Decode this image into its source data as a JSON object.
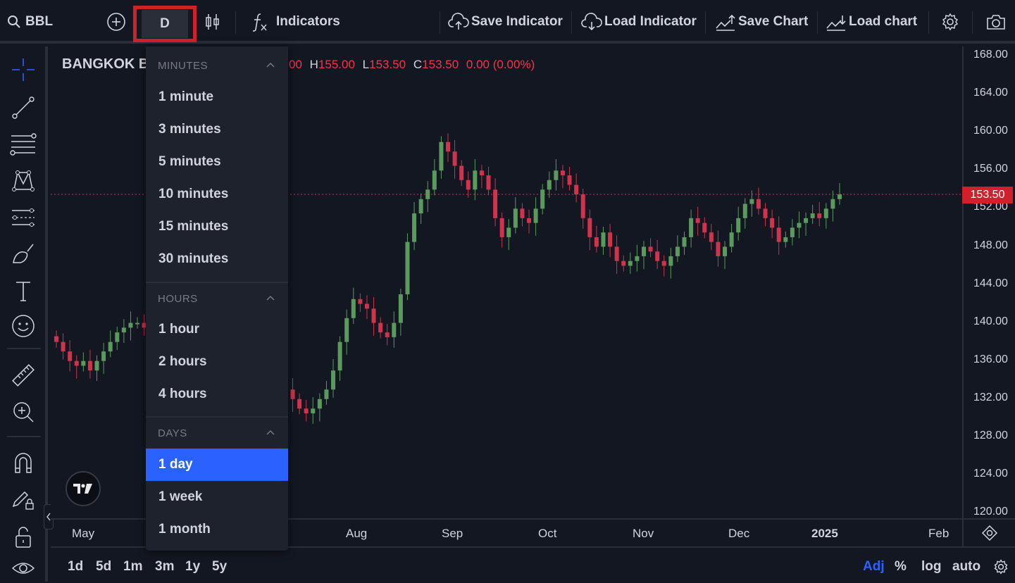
{
  "toolbar": {
    "symbol": "BBL",
    "interval": "D",
    "indicators": "Indicators",
    "save_indicator": "Save Indicator",
    "load_indicator": "Load Indicator",
    "save_chart": "Save Chart",
    "load_chart": "Load chart"
  },
  "legend": {
    "symbol_name": "BANGKOK B",
    "open_value": "00",
    "high_label": "H",
    "high_value": "155.00",
    "low_label": "L",
    "low_value": "153.50",
    "close_label": "C",
    "close_value": "153.50",
    "change": "0.00 (0.00%)"
  },
  "interval_menu": {
    "sections": [
      {
        "title": "MINUTES",
        "items": [
          "1 minute",
          "3 minutes",
          "5 minutes",
          "10 minutes",
          "15 minutes",
          "30 minutes"
        ]
      },
      {
        "title": "HOURS",
        "items": [
          "1 hour",
          "2 hours",
          "4 hours"
        ]
      },
      {
        "title": "DAYS",
        "items": [
          "1 day",
          "1 week",
          "1 month"
        ]
      }
    ],
    "selected": "1 day"
  },
  "y_axis": {
    "ticks": [
      "168.00",
      "164.00",
      "160.00",
      "156.00",
      "152.00",
      "148.00",
      "144.00",
      "140.00",
      "136.00",
      "132.00",
      "128.00",
      "124.00",
      "120.00"
    ],
    "last_price": "153.50"
  },
  "x_axis": {
    "ticks": [
      "May",
      "Aug",
      "Sep",
      "Oct",
      "Nov",
      "Dec",
      "2025",
      "Feb"
    ]
  },
  "bottom": {
    "ranges": [
      "1d",
      "5d",
      "1m",
      "3m",
      "1y",
      "5y"
    ],
    "adj": "Adj",
    "percent": "%",
    "log": "log",
    "auto": "auto"
  },
  "colors": {
    "up": "#5b9a5d",
    "down": "#d0334b",
    "accent": "#2962ff",
    "highlight": "#d0202c"
  },
  "chart_data": {
    "type": "candlestick",
    "closes": [
      138,
      137,
      136,
      135.5,
      136,
      135,
      136,
      137,
      138,
      139,
      139.5,
      140,
      140,
      139.5,
      140,
      140.2,
      140,
      139.5,
      140,
      137,
      136,
      134,
      133,
      135,
      136.5,
      135,
      134,
      133,
      132.5,
      134,
      135.5,
      137,
      136,
      134,
      133,
      132,
      131,
      130.5,
      131,
      132,
      133,
      135,
      138,
      140.5,
      142.5,
      142,
      141.5,
      140,
      139,
      138.5,
      140,
      143,
      148.5,
      151.5,
      153,
      154,
      156,
      159,
      158,
      156.5,
      155,
      154,
      156,
      155.5,
      154,
      151,
      149,
      150,
      152,
      151,
      150.5,
      152,
      154,
      155,
      156,
      155.5,
      154.5,
      153.5,
      151,
      149,
      148,
      149.5,
      148,
      146.5,
      146,
      146.5,
      147,
      148,
      147.5,
      146.5,
      146,
      147,
      148,
      149,
      151,
      150.5,
      149.5,
      148.5,
      147,
      148,
      149.5,
      151,
      152.5,
      153,
      152,
      151,
      150,
      148.5,
      149,
      150,
      150.5,
      151,
      151.5,
      151,
      152,
      153,
      153.5
    ]
  }
}
